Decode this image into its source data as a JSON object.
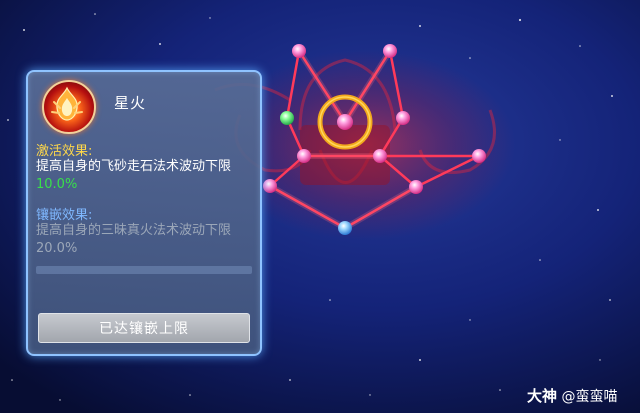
{
  "panel": {
    "item_name": "星火",
    "icon": "fire-emblem-icon",
    "activation": {
      "title": "激活效果:",
      "text_prefix": "提高自身的飞砂走石法术波动下限",
      "value": "10.0%"
    },
    "inlay": {
      "title": "镶嵌效果:",
      "text_prefix": "提高自身的三昧真火法术波动下限",
      "value": "20.0%"
    },
    "button_label": "已达镶嵌上限"
  },
  "watermark": {
    "brand": "大神",
    "handle": "@蛮蛮喵"
  },
  "colors": {
    "activation_title": "#ffd84a",
    "inlay_title": "#7fb8ff",
    "highlight_value": "#38e04a",
    "constellation_line": "#ff3a5a",
    "selection_ring": "#f2a81c"
  }
}
